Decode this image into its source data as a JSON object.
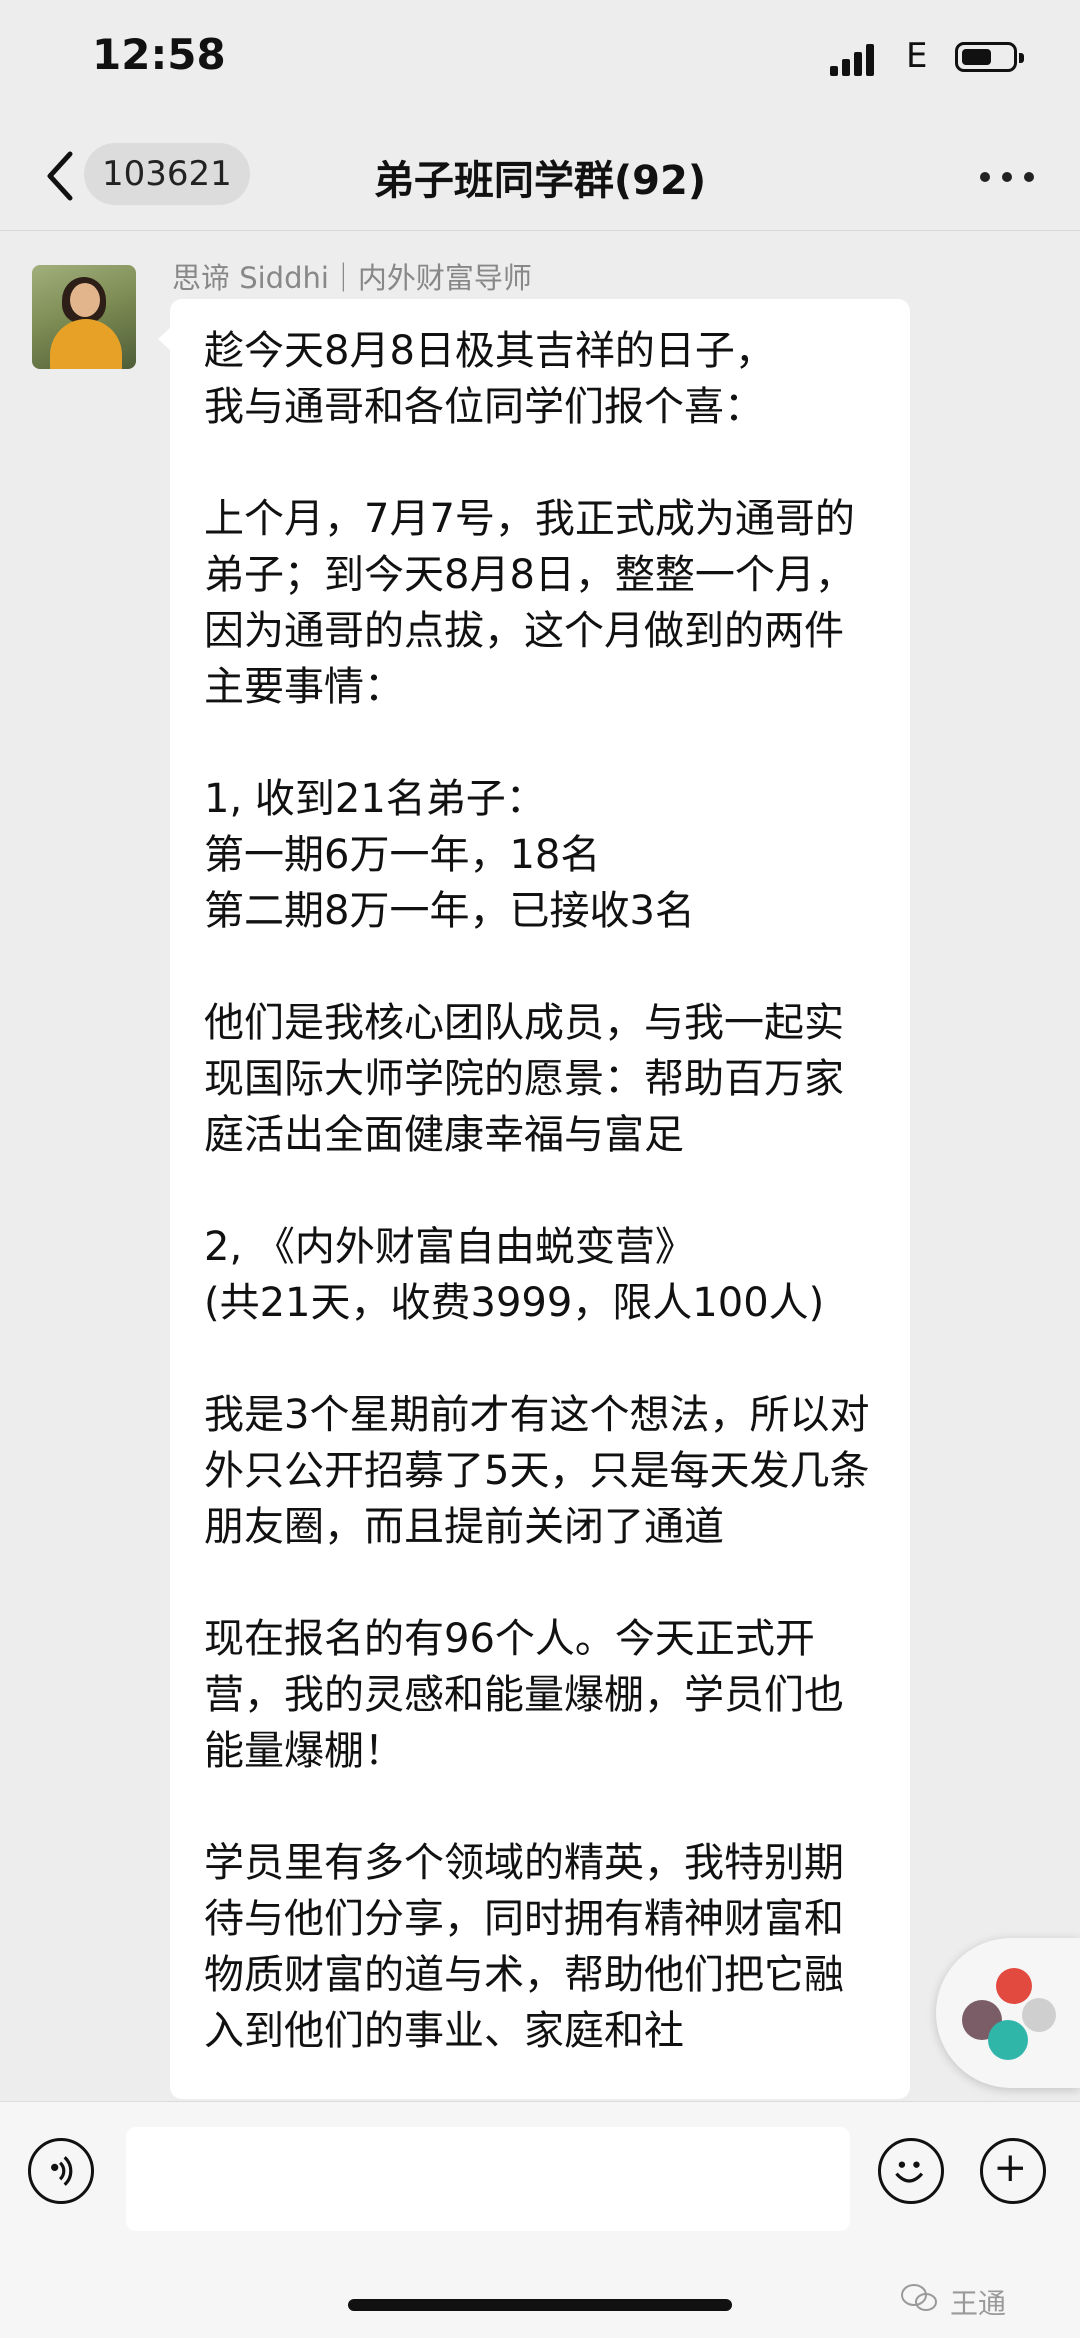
{
  "status_bar": {
    "time": "12:58",
    "carrier": "E",
    "battery_level": 0.6
  },
  "nav": {
    "unread_count": "103621",
    "title": "弟子班同学群(92)"
  },
  "message": {
    "sender": "思谛 Siddhi｜内外财富导师",
    "text": "趁今天8月8日极其吉祥的日子，\n我与通哥和各位同学们报个喜：\n\n上个月，7月7号，我正式成为通哥的弟子；到今天8月8日，整整一个月，因为通哥的点拔，这个月做到的两件主要事情：\n\n1, 收到21名弟子：\n第一期6万一年，18名\n第二期8万一年，已接收3名\n\n他们是我核心团队成员，与我一起实现国际大师学院的愿景：帮助百万家庭活出全面健康幸福与富足\n\n2, 《内外财富自由蜕变营》\n(共21天，收费3999，限人100人)\n\n我是3个星期前才有这个想法，所以对外只公开招募了5天，只是每天发几条朋友圈，而且提前关闭了通道\n\n现在报名的有96个人。今天正式开营，我的灵感和能量爆棚，学员们也能量爆棚！\n\n学员里有多个领域的精英，我特别期待与他们分享，同时拥有精神财富和物质财富的道与术，帮助他们把它融入到他们的事业、家庭和社"
  },
  "input_bar": {
    "icons": [
      "voice-icon",
      "emoji-icon",
      "plus-icon"
    ]
  },
  "watermark": {
    "label": "王通"
  }
}
